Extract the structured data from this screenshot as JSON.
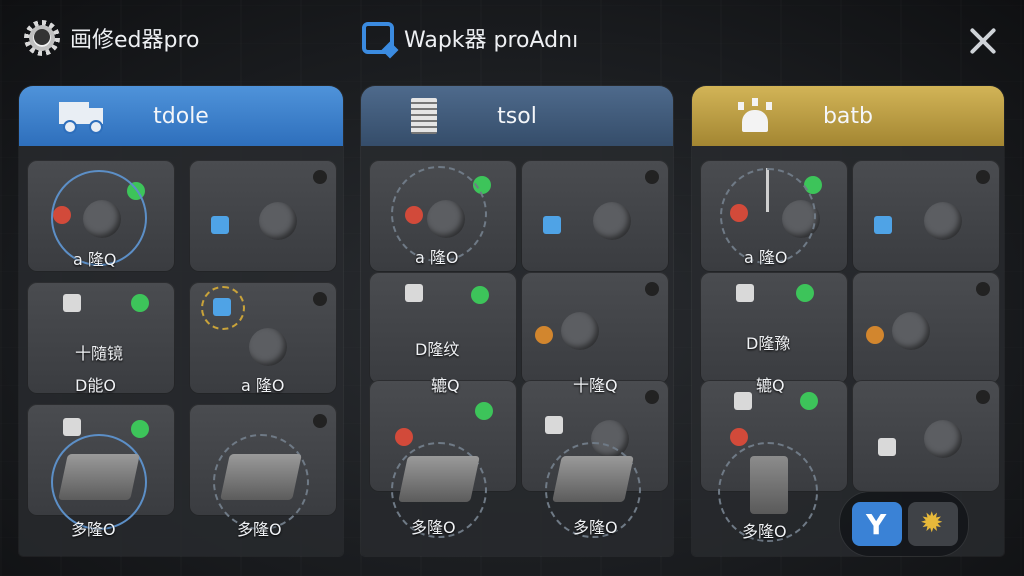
{
  "header": {
    "left_title": "画修ed器pro",
    "center_title": "Wapk器 proAdnı",
    "left_icon": "gear-icon",
    "center_icon": "scanner-icon",
    "close_icon": "close-icon"
  },
  "panels": [
    {
      "title": "tdole",
      "icon": "truck-icon",
      "accent": "#3f84cf",
      "slots": [
        {
          "label": "a 隆Q"
        },
        {
          "label": ""
        },
        {
          "label": "十隨镜"
        },
        {
          "label": ""
        },
        {
          "label": "D能O"
        },
        {
          "label": "a 隆O"
        },
        {
          "label": "多隆O"
        },
        {
          "label": "多隆O"
        }
      ]
    },
    {
      "title": "tsol",
      "icon": "document-icon",
      "accent": "#415a7a",
      "slots": [
        {
          "label": "a 隆O"
        },
        {
          "label": ""
        },
        {
          "label": "D隆纹"
        },
        {
          "label": ""
        },
        {
          "label": "辘Q"
        },
        {
          "label": "十隆Q"
        },
        {
          "label": "多隆O"
        },
        {
          "label": "多隆O"
        }
      ]
    },
    {
      "title": "batb",
      "icon": "alarm-icon",
      "accent": "#c3a343",
      "slots": [
        {
          "label": "a 隆O"
        },
        {
          "label": ""
        },
        {
          "label": "D隆豫"
        },
        {
          "label": ""
        },
        {
          "label": "辘Q"
        },
        {
          "label": ""
        },
        {
          "label": "多隆O"
        },
        {
          "label": ""
        }
      ]
    }
  ],
  "dock": {
    "primary_icon": "fork-icon",
    "secondary_icon": "sun-icon"
  }
}
